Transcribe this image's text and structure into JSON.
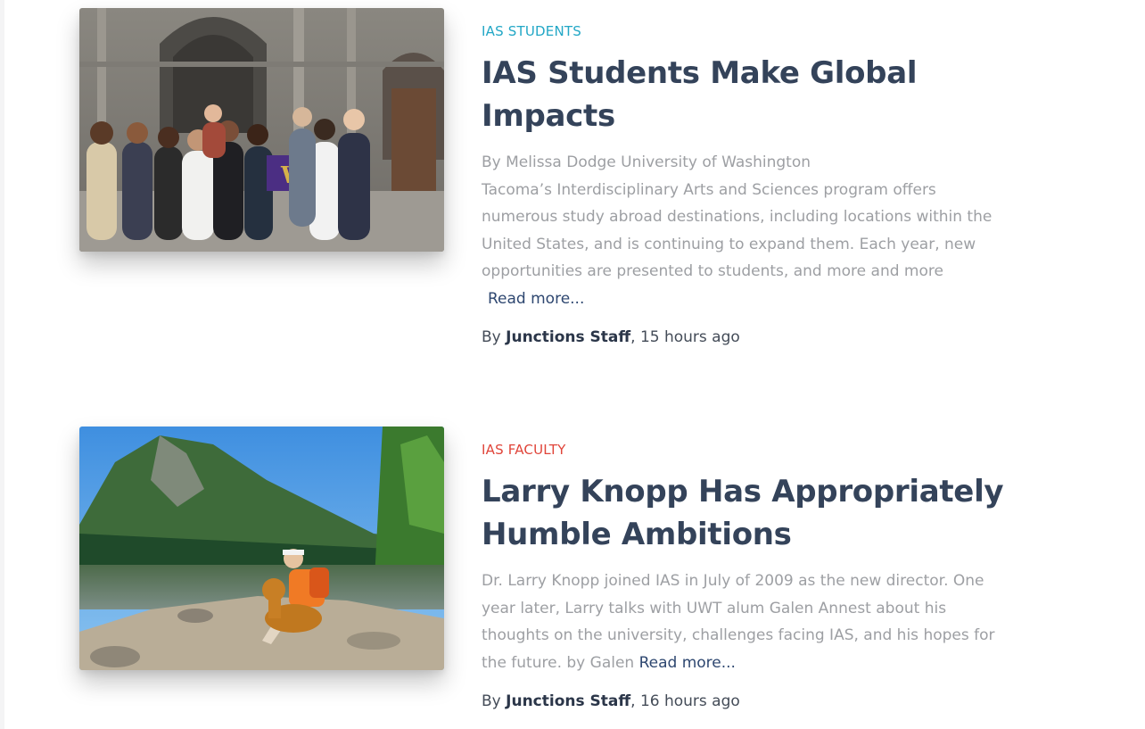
{
  "posts": [
    {
      "category": "IAS STUDENTS",
      "category_color": "#22a7c6",
      "title_lines": [
        "IAS Students Make Global",
        "Impacts"
      ],
      "excerpt_lines": [
        "By Melissa Dodge University of Washington",
        "Tacoma’s Interdisciplinary Arts and Sciences program offers",
        "numerous study abroad destinations, including locations within the",
        "United States, and is continuing to expand them. Each year, new",
        "opportunities are presented to students, and more and more"
      ],
      "excerpt_tail": "",
      "read_more": "Read more...",
      "byline_prefix": "By ",
      "author": "Junctions Staff",
      "time": ", 15 hours ago",
      "image_icon": "group-photo-cathedral"
    },
    {
      "category": "IAS FACULTY",
      "category_color": "#e0453a",
      "title_lines": [
        "Larry Knopp Has Appropriately",
        "Humble Ambitions"
      ],
      "excerpt_lines": [
        "Dr. Larry Knopp joined IAS in July of 2009 as the new director. One",
        "year later, Larry talks with UWT alum Galen Annest about his",
        "thoughts on the university, challenges facing IAS, and his hopes for"
      ],
      "excerpt_tail": "the future. by Galen ",
      "read_more": "Read more...",
      "byline_prefix": "By ",
      "author": "Junctions Staff",
      "time": ", 16 hours ago",
      "image_icon": "lake-hiker-dog-photo"
    }
  ]
}
